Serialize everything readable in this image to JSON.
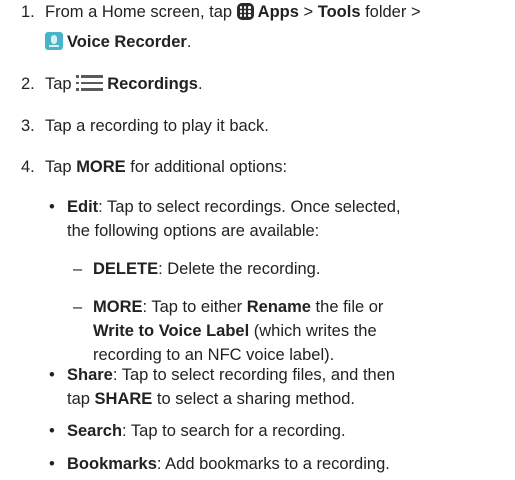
{
  "steps": [
    {
      "num": "1.",
      "pre": "From a Home screen, tap ",
      "apps": "Apps",
      "sep1": " > ",
      "tools": "Tools",
      "folder": " folder >",
      "app": "Voice Recorder",
      "end": "."
    },
    {
      "num": "2.",
      "pre": "Tap ",
      "recordings": "Recordings",
      "end": "."
    },
    {
      "num": "3.",
      "text": "Tap a recording to play it back."
    },
    {
      "num": "4.",
      "pre": "Tap ",
      "more": "MORE",
      "post": " for additional options:"
    }
  ],
  "options": [
    {
      "bullet": "•",
      "term": "Edit",
      "text1": ": Tap to select recordings. Once selected,",
      "text2": "the following options are available:"
    },
    {
      "bullet": "•",
      "term": "Share",
      "text1": ": Tap to select recording files, and then",
      "line2_pre": "tap ",
      "line2_term": "SHARE",
      "line2_post": " to select a sharing method."
    },
    {
      "bullet": "•",
      "term": "Search",
      "text1": ": Tap to search for a recording."
    },
    {
      "bullet": "•",
      "term": "Bookmarks",
      "text1": ": Add bookmarks to a recording."
    }
  ],
  "sub_options": [
    {
      "dash": "–",
      "term": "DELETE",
      "text1": ": Delete the recording."
    },
    {
      "dash": "–",
      "term": "MORE",
      "text1": ": Tap to either ",
      "term2": "Rename",
      "text2": " the file or",
      "term3": "Write to Voice Label",
      "text3": " (which writes the",
      "text4": "recording to an NFC voice label)."
    }
  ],
  "icons": {
    "apps": "apps-grid-icon",
    "voice_recorder": "voice-recorder-app-icon",
    "recordings": "list-icon"
  },
  "colors": {
    "text": "#222222",
    "apps_icon": "#2b2b2b",
    "voice_recorder_icon": "#49b4c9",
    "list_icon": "#5a5a5a"
  }
}
